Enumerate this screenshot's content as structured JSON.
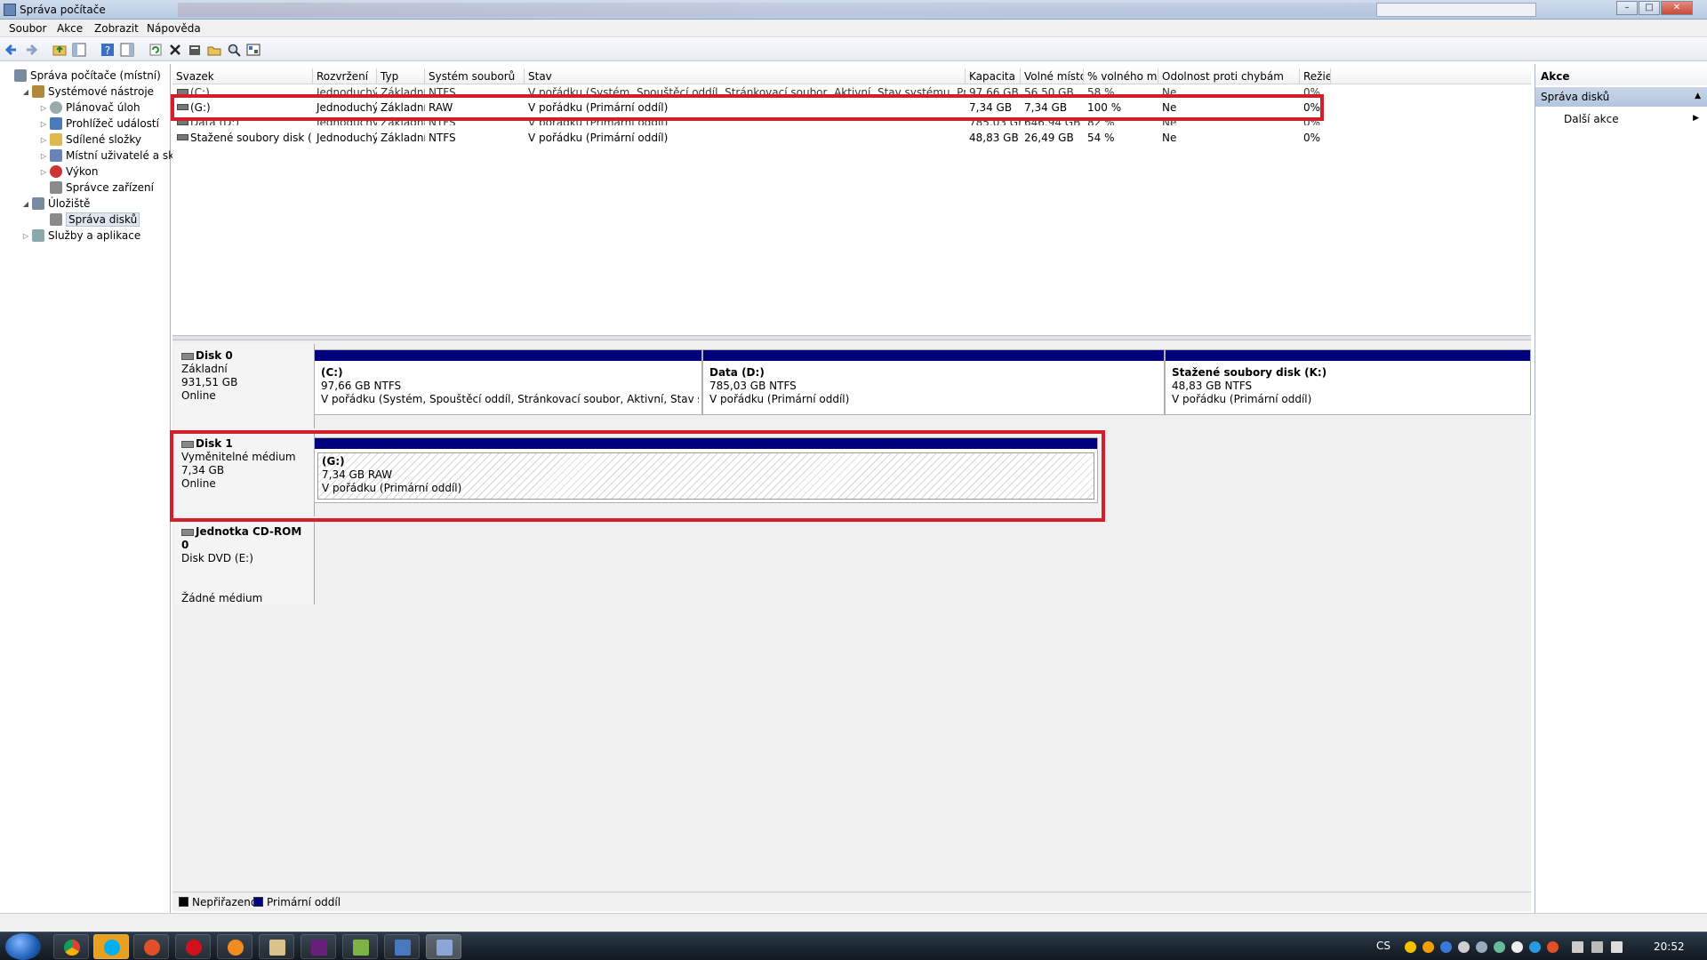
{
  "window": {
    "title": "Správa počítače"
  },
  "menu": [
    "Soubor",
    "Akce",
    "Zobrazit",
    "Nápověda"
  ],
  "tree": [
    {
      "label": "Správa počítače (místní)",
      "indent": 0,
      "exp": "",
      "icon": "computer-icon"
    },
    {
      "label": "Systémové nástroje",
      "indent": 1,
      "exp": "◢",
      "icon": "tools-icon"
    },
    {
      "label": "Plánovač úloh",
      "indent": 2,
      "exp": "▷",
      "icon": "clock-icon"
    },
    {
      "label": "Prohlížeč událostí",
      "indent": 2,
      "exp": "▷",
      "icon": "event-viewer-icon"
    },
    {
      "label": "Sdílené složky",
      "indent": 2,
      "exp": "▷",
      "icon": "shared-folder-icon"
    },
    {
      "label": "Místní uživatelé a skupi",
      "indent": 2,
      "exp": "▷",
      "icon": "users-icon"
    },
    {
      "label": "Výkon",
      "indent": 2,
      "exp": "▷",
      "icon": "performance-icon"
    },
    {
      "label": "Správce zařízení",
      "indent": 2,
      "exp": "",
      "icon": "device-manager-icon"
    },
    {
      "label": "Úložiště",
      "indent": 1,
      "exp": "◢",
      "icon": "storage-icon"
    },
    {
      "label": "Správa disků",
      "indent": 2,
      "exp": "",
      "icon": "disk-management-icon",
      "selected": true
    },
    {
      "label": "Služby a aplikace",
      "indent": 1,
      "exp": "▷",
      "icon": "services-icon"
    }
  ],
  "volume_table": {
    "columns": [
      "Svazek",
      "Rozvržení",
      "Typ",
      "Systém souborů",
      "Stav",
      "Kapacita",
      "Volné místo",
      "% volného místa",
      "Odolnost proti chybám",
      "Režie"
    ],
    "rows": [
      [
        "(C:)",
        "Jednoduchý",
        "Základní",
        "NTFS",
        "V pořádku (Systém, Spouštěcí oddíl, Stránkovací soubor, Aktivní, Stav systému, Primární oddíl)",
        "97,66 GB",
        "56,50 GB",
        "58 %",
        "Ne",
        "0%"
      ],
      [
        "(G:)",
        "Jednoduchý",
        "Základní",
        "RAW",
        "V pořádku (Primární oddíl)",
        "7,34 GB",
        "7,34 GB",
        "100 %",
        "Ne",
        "0%"
      ],
      [
        "Data (D:)",
        "Jednoduchý",
        "Základní",
        "NTFS",
        "V pořádku (Primární oddíl)",
        "785,03 GB",
        "646,94 GB",
        "82 %",
        "Ne",
        "0%"
      ],
      [
        "Stažené soubory disk (K:)",
        "Jednoduchý",
        "Základní",
        "NTFS",
        "V pořádku (Primární oddíl)",
        "48,83 GB",
        "26,49 GB",
        "54 %",
        "Ne",
        "0%"
      ]
    ]
  },
  "disks": [
    {
      "name": "Disk 0",
      "type": "Základní",
      "size": "931,51 GB",
      "status": "Online",
      "extra": "",
      "partitions": [
        {
          "name": "(C:)",
          "size": "97,66 GB NTFS",
          "status": "V pořádku (Systém, Spouštěcí oddíl, Stránkovací soubor, Aktivní, Stav systému, P"
        },
        {
          "name": "Data  (D:)",
          "size": "785,03 GB NTFS",
          "status": "V pořádku (Primární oddíl)"
        },
        {
          "name": "Stažené soubory disk  (K:)",
          "size": "48,83 GB NTFS",
          "status": "V pořádku (Primární oddíl)"
        }
      ]
    },
    {
      "name": "Disk 1",
      "type": "Vyměnitelné médium",
      "size": "7,34 GB",
      "status": "Online",
      "extra": "",
      "partitions": [
        {
          "name": "(G:)",
          "size": "7,34 GB RAW",
          "status": "V pořádku (Primární oddíl)"
        }
      ]
    },
    {
      "name": "Jednotka CD-ROM 0",
      "type": "Disk DVD (E:)",
      "size": "",
      "status": "",
      "extra": "Žádné médium",
      "partitions": []
    }
  ],
  "legend": [
    {
      "label": "Nepřiřazeno",
      "color": "#000000"
    },
    {
      "label": "Primární oddíl",
      "color": "#00007c"
    }
  ],
  "actions": {
    "title": "Akce",
    "section": "Správa disků",
    "item": "Další akce"
  },
  "taskbar": {
    "lang": "CS",
    "clock": "20:52"
  },
  "colors": {
    "highlight": "#d31e2b",
    "partition_bar": "#00007c"
  }
}
